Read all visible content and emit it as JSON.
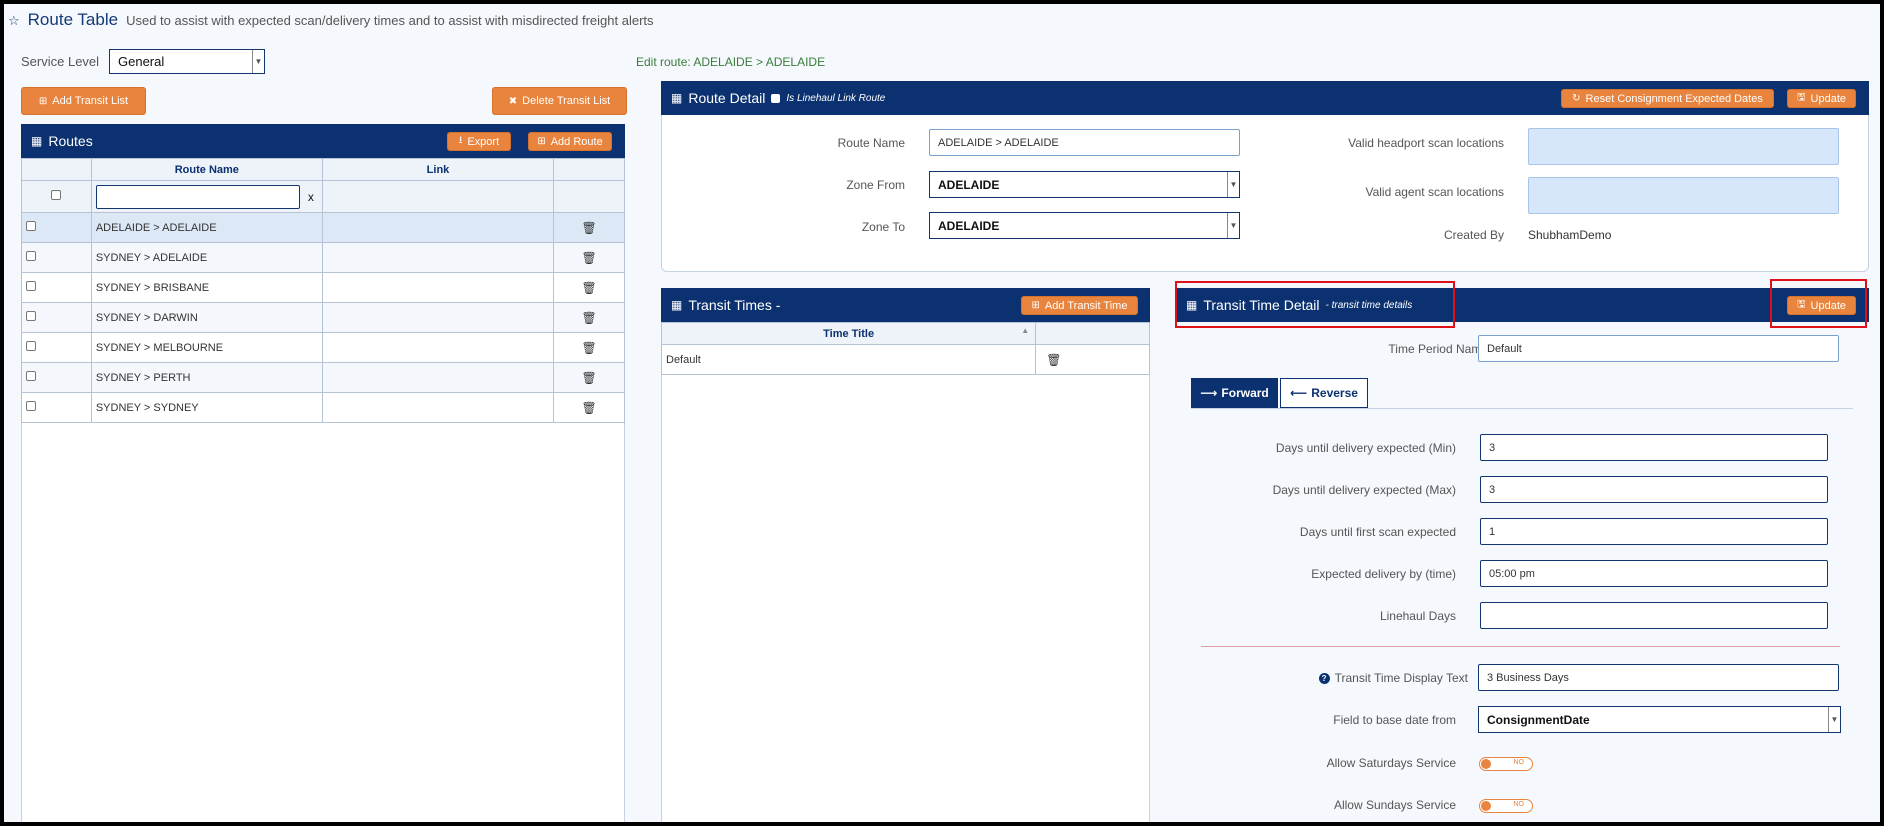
{
  "page": {
    "title": "Route Table",
    "subtitle": "Used to assist with expected scan/delivery times and to assist with misdirected freight alerts"
  },
  "service_level": {
    "label": "Service Level",
    "value": "General"
  },
  "buttons": {
    "add_transit_list": "Add Transit List",
    "delete_transit_list": "Delete Transit List",
    "export": "Export",
    "add_route": "Add Route",
    "reset_consignment": "Reset Consignment Expected Dates",
    "update_route": "Update",
    "add_transit_time": "Add Transit Time",
    "update_transit": "Update"
  },
  "routes": {
    "title": "Routes",
    "columns": [
      "Route Name",
      "Link"
    ],
    "filter_clear": "x",
    "rows": [
      "ADELAIDE > ADELAIDE",
      "SYDNEY > ADELAIDE",
      "SYDNEY > BRISBANE",
      "SYDNEY > DARWIN",
      "SYDNEY > MELBOURNE",
      "SYDNEY > PERTH",
      "SYDNEY > SYDNEY"
    ]
  },
  "edit_route": "Edit route: ADELAIDE > ADELAIDE",
  "route_detail": {
    "title": "Route Detail",
    "checkbox_label": "Is Linehaul Link Route",
    "route_name_label": "Route Name",
    "route_name_value": "ADELAIDE > ADELAIDE",
    "zone_from_label": "Zone From",
    "zone_from_value": "ADELAIDE",
    "zone_to_label": "Zone To",
    "zone_to_value": "ADELAIDE",
    "headport_label": "Valid headport scan locations",
    "agent_label": "Valid agent scan locations",
    "created_by_label": "Created By",
    "created_by_value": "ShubhamDemo"
  },
  "transit_times": {
    "title": "Transit Times -",
    "column": "Time Title",
    "rows": [
      "Default"
    ]
  },
  "transit_detail": {
    "title": "Transit Time Detail",
    "subtitle": "- transit time details",
    "period_label": "Time Period Name",
    "period_value": "Default",
    "tab_forward": "Forward",
    "tab_reverse": "Reverse",
    "min_label": "Days until delivery expected (Min)",
    "min_value": "3",
    "max_label": "Days until delivery expected (Max)",
    "max_value": "3",
    "first_scan_label": "Days until first scan expected",
    "first_scan_value": "1",
    "delivery_time_label": "Expected delivery by (time)",
    "delivery_time_value": "05:00 pm",
    "linehaul_label": "Linehaul Days",
    "linehaul_value": "",
    "display_text_label": "Transit Time Display Text",
    "display_text_value": "3 Business Days",
    "base_date_label": "Field to base date from",
    "base_date_value": "ConsignmentDate",
    "saturday_label": "Allow Saturdays Service",
    "sunday_label": "Allow Sundays Service",
    "toggle_no": "NO"
  }
}
